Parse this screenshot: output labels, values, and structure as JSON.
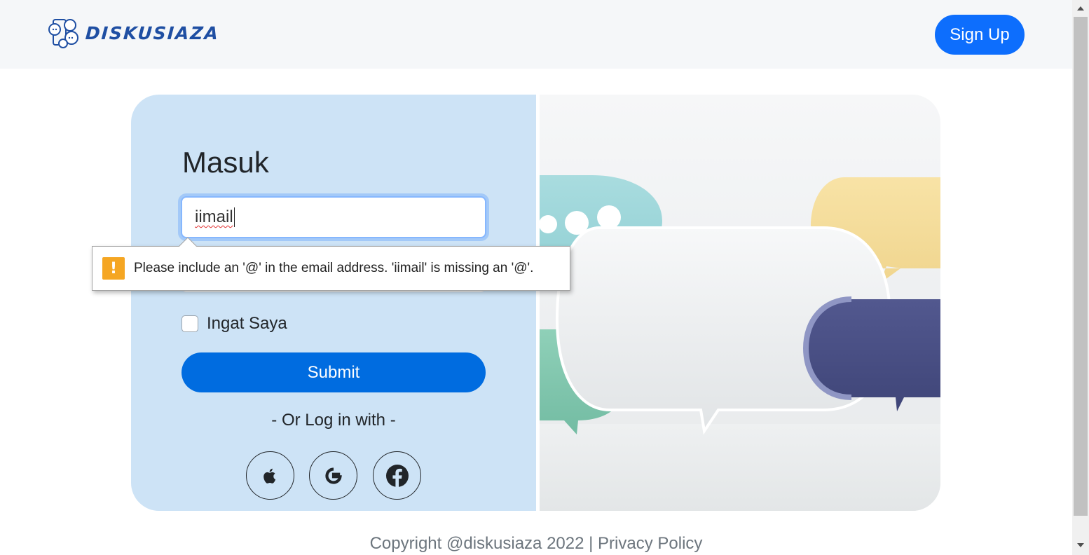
{
  "navbar": {
    "brand": "DISKUSIAZA",
    "signup_label": "Sign Up"
  },
  "login": {
    "title": "Masuk",
    "email_value": "iimail",
    "remember_label": "Ingat Saya",
    "submit_label": "Submit",
    "or_text": "- Or Log in with -",
    "social": [
      "apple-icon",
      "google-icon",
      "facebook-icon"
    ]
  },
  "validation": {
    "icon": "warning-icon",
    "message": "Please include an '@' in the email address. 'iimail' is missing an '@'."
  },
  "footer": {
    "copyright": "Copyright @diskusiaza 2022",
    "separator": "|",
    "privacy": "Privacy Policy"
  },
  "colors": {
    "primary": "#0d6efd",
    "panel": "#cde3f6",
    "brand": "#1f4fa3",
    "warning": "#f5a623"
  }
}
